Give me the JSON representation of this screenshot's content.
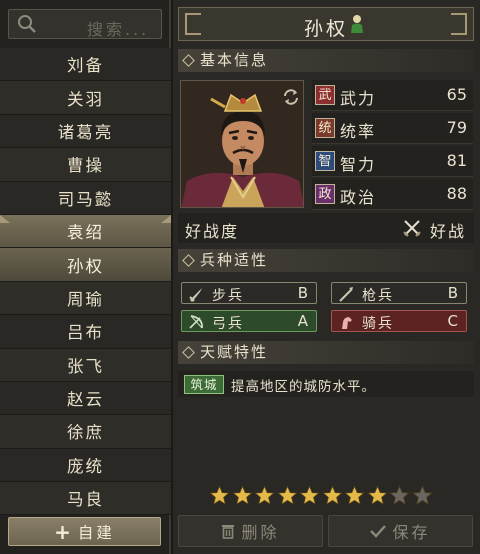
{
  "search": {
    "placeholder": "搜索..."
  },
  "officers": [
    "刘备",
    "关羽",
    "诸葛亮",
    "曹操",
    "司马懿",
    "袁绍",
    "孙权",
    "周瑜",
    "吕布",
    "张飞",
    "赵云",
    "徐庶",
    "庞统",
    "马良"
  ],
  "create_label": "自建",
  "detail": {
    "name": "孙权",
    "basic_section": "基本信息",
    "stats": [
      {
        "badge": "武",
        "label": "武力",
        "value": "65",
        "color": "#8c2f2f"
      },
      {
        "badge": "统",
        "label": "统率",
        "value": "79",
        "color": "#7a3a2a"
      },
      {
        "badge": "智",
        "label": "智力",
        "value": "81",
        "color": "#2d4a7a"
      },
      {
        "badge": "政",
        "label": "政治",
        "value": "88",
        "color": "#6a2f6a"
      }
    ],
    "combat": {
      "label": "好战度",
      "value": "好战"
    },
    "troop_section": "兵种适性",
    "troops": [
      {
        "name": "步兵",
        "grade": "B",
        "style": "plain",
        "icon": "sword-icon"
      },
      {
        "name": "枪兵",
        "grade": "B",
        "style": "plain",
        "icon": "spear-icon"
      },
      {
        "name": "弓兵",
        "grade": "A",
        "style": "green",
        "icon": "bow-icon"
      },
      {
        "name": "骑兵",
        "grade": "C",
        "style": "red",
        "icon": "horse-icon"
      }
    ],
    "talent_section": "天赋特性",
    "talent": {
      "tag": "筑城",
      "desc": "提高地区的城防水平。"
    },
    "rating": {
      "filled": 8,
      "total": 10
    },
    "delete_label": "删除",
    "save_label": "保存"
  },
  "colors": {
    "selected_row": "#7a715a",
    "star_on": "#e3b94a",
    "star_off": "#6a6760"
  }
}
